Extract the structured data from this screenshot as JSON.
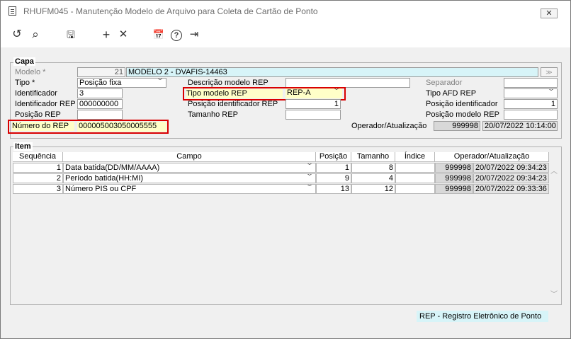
{
  "window": {
    "title": "RHUFM045 - Manutenção Modelo de Arquivo para Coleta de Cartão de Ponto",
    "close_glyph": "✕"
  },
  "toolbar": {
    "icons": [
      "undo-icon",
      "search-icon",
      "save-icon",
      "add-icon",
      "delete-icon",
      "calendar-icon",
      "help-icon",
      "exit-icon"
    ],
    "glyphs": {
      "undo": "↺",
      "search": "⌕",
      "save": "🖫",
      "add": "+",
      "delete": "✕",
      "calendar": "📅",
      "help": "?",
      "exit": "⇥"
    }
  },
  "capa": {
    "legend": "Capa",
    "modelo_label": "Modelo *",
    "modelo_code": "21",
    "modelo_desc": "MODELO 2 - DVAFIS-14463",
    "tipo_label": "Tipo *",
    "tipo_value": "Posição fixa",
    "identificador_label": "Identificador",
    "identificador_value": "3",
    "identificador_rep_label": "Identificador REP",
    "identificador_rep_value": "000000000",
    "posicao_rep_label": "Posição REP",
    "posicao_rep_value": "",
    "numero_rep_label": "Número do REP",
    "numero_rep_value": "000005003050005555",
    "descricao_modelo_label": "Descrição modelo REP",
    "descricao_modelo_value": "",
    "tipo_modelo_label": "Tipo modelo REP",
    "tipo_modelo_value": "REP-A",
    "posicao_identificador_rep_label": "Posição identificador REP",
    "posicao_identificador_rep_value": "1",
    "tamanho_rep_label": "Tamanho REP",
    "tamanho_rep_value": "",
    "separador_label": "Separador",
    "separador_value": "",
    "tipo_afd_label": "Tipo AFD REP",
    "tipo_afd_value": "",
    "posicao_identificador_label": "Posição identificador",
    "posicao_identificador_value": "1",
    "posicao_modelo_label": "Posição modelo REP",
    "posicao_modelo_value": "",
    "operador_label": "Operador/Atualização",
    "operador_value": "999998",
    "atualizacao_value": "20/07/2022 10:14:00"
  },
  "item": {
    "legend": "Item",
    "columns": [
      "Sequência",
      "Campo",
      "Posição",
      "Tamanho",
      "Índice",
      "Operador/Atualização"
    ],
    "rows": [
      {
        "seq": "1",
        "campo": "Data batida(DD/MM/AAAA)",
        "posicao": "1",
        "tamanho": "8",
        "indice": "",
        "operador": "999998",
        "atualizacao": "20/07/2022 09:34:23"
      },
      {
        "seq": "2",
        "campo": "Período batida(HH:MI)",
        "posicao": "9",
        "tamanho": "4",
        "indice": "",
        "operador": "999998",
        "atualizacao": "20/07/2022 09:34:23"
      },
      {
        "seq": "3",
        "campo": "Número PIS ou CPF",
        "posicao": "13",
        "tamanho": "12",
        "indice": "",
        "operador": "999998",
        "atualizacao": "20/07/2022 09:33:36"
      }
    ]
  },
  "status": {
    "text": "REP - Registro Eletrônico de Ponto"
  },
  "colors": {
    "highlight_red": "#d90000",
    "cyan_field": "#d7f4f8",
    "yellow_field": "#ffffc8"
  }
}
